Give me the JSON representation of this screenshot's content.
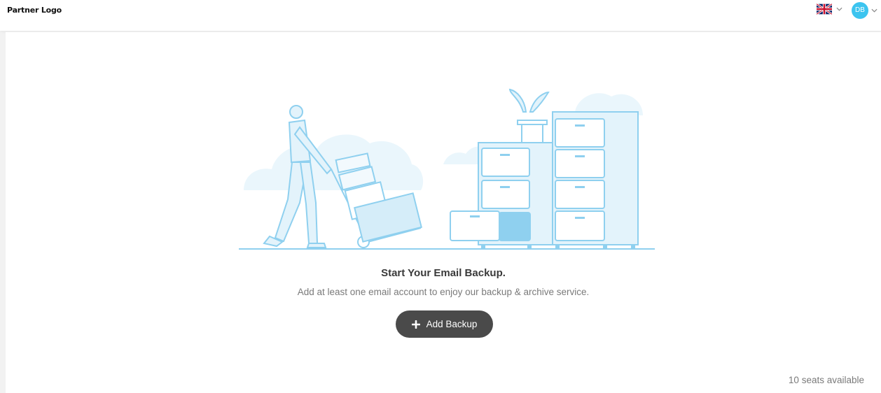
{
  "header": {
    "logo_text": "Partner Logo",
    "language_flag": "uk-flag-icon",
    "user_initials": "DB",
    "avatar_color": "#3cc4ef"
  },
  "empty_state": {
    "title": "Start Your Email Backup.",
    "subtitle": "Add at least one email account to enjoy our backup & archive service.",
    "add_button_label": "Add Backup",
    "add_button_icon": "plus-icon"
  },
  "footer": {
    "seats_text": "10 seats available"
  },
  "colors": {
    "illustration_stroke": "#8fd0ef",
    "illustration_fill": "#eaf6fc",
    "button_bg": "#4a4a4a"
  }
}
